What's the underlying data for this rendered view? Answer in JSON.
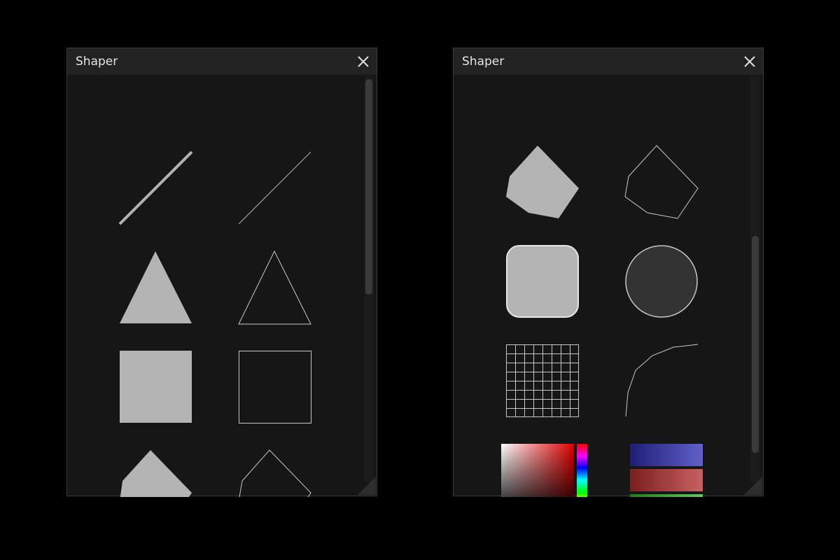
{
  "colors": {
    "window_bg": "#161616",
    "titlebar_bg": "#222222",
    "shape_fill": "#b4b4b4",
    "shape_stroke": "#c8c8c8",
    "scroll_thumb": "#3b3b3b"
  },
  "windows": [
    {
      "title": "Shaper",
      "close_icon": "close-icon",
      "scroll_position": 0.0,
      "shapes": [
        "line-thick",
        "line-thin",
        "triangle-filled",
        "triangle-outline",
        "square-filled",
        "square-outline",
        "pentagon-filled",
        "pentagon-outline"
      ]
    },
    {
      "title": "Shaper",
      "close_icon": "close-icon",
      "scroll_position": 1.0,
      "shapes": [
        "pentagon-filled",
        "pentagon-outline",
        "rounded-rect-filled",
        "circle-filled-outline",
        "grid",
        "curve",
        "color-picker",
        "gradient-bars"
      ]
    }
  ]
}
